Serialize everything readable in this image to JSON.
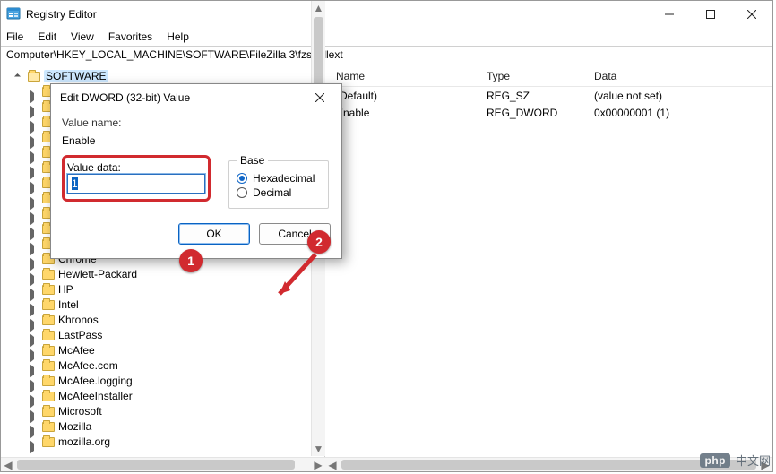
{
  "window": {
    "title": "Registry Editor"
  },
  "menu": {
    "file": "File",
    "edit": "Edit",
    "view": "View",
    "favorites": "Favorites",
    "help": "Help"
  },
  "address": "Computer\\HKEY_LOCAL_MACHINE\\SOFTWARE\\FileZilla 3\\fzshellext",
  "tree": {
    "root": "SOFTWARE",
    "items": [
      "",
      "",
      "",
      "",
      "",
      "",
      "",
      "",
      "",
      "",
      "",
      "Chrome",
      "Hewlett-Packard",
      "HP",
      "Intel",
      "Khronos",
      "LastPass",
      "McAfee",
      "McAfee.com",
      "McAfee.logging",
      "McAfeeInstaller",
      "Microsoft",
      "Mozilla",
      "mozilla.org"
    ]
  },
  "list": {
    "headers": {
      "name": "Name",
      "type": "Type",
      "data": "Data"
    },
    "rows": [
      {
        "name": "(Default)",
        "type": "REG_SZ",
        "data": "(value not set)"
      },
      {
        "name": "Enable",
        "type": "REG_DWORD",
        "data": "0x00000001 (1)"
      }
    ]
  },
  "dialog": {
    "title": "Edit DWORD (32-bit) Value",
    "value_name_label": "Value name:",
    "value_name": "Enable",
    "value_data_label": "Value data:",
    "value_data": "1",
    "base_label": "Base",
    "hex": "Hexadecimal",
    "dec": "Decimal",
    "ok": "OK",
    "cancel": "Cancel"
  },
  "annot": {
    "m1": "1",
    "m2": "2"
  },
  "watermark": {
    "badge": "php",
    "text": "中文网"
  }
}
